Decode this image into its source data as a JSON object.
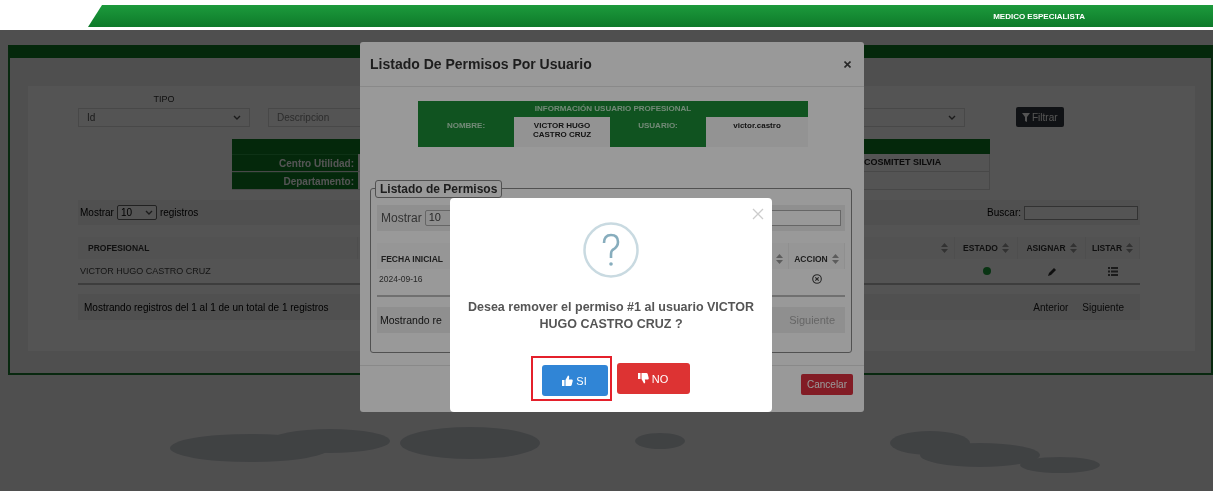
{
  "header": {
    "role": "MEDICO ESPECIALISTA"
  },
  "filter": {
    "tipo_label": "TIPO",
    "tipo_value": "Id",
    "descripcion_placeholder": "Descripcion",
    "filter_button": "Filtrar"
  },
  "info_table": {
    "rows": [
      {
        "label": "Centro Utilidad:",
        "value": "COSMITET SILVIA"
      },
      {
        "label": "Departamento:"
      }
    ]
  },
  "professionals": {
    "show_label": "Mostrar",
    "page_size": "10",
    "records_label": "registros",
    "search_label": "Buscar:",
    "columns": [
      {
        "label": "PROFESIONAL"
      },
      {
        "label": "ESTADO"
      },
      {
        "label": "ASIGNAR"
      },
      {
        "label": "LISTAR"
      }
    ],
    "rows": [
      {
        "profesional": "VICTOR HUGO CASTRO CRUZ",
        "active": true
      }
    ],
    "footer": "Mostrando registros del 1 al 1 de un total de 1 registros",
    "previous": "Anterior",
    "next": "Siguiente"
  },
  "modal": {
    "title": "Listado De Permisos Por Usuario",
    "info_title": "INFORMACIÓN USUARIO PROFESIONAL",
    "nombre_label": "NOMBRE:",
    "nombre_value": "VICTOR HUGO CASTRO CRUZ",
    "usuario_label": "USUARIO:",
    "usuario_value": "victor.castro",
    "legend": "Listado de Permisos",
    "show_label": "Mostrar",
    "page_size": "10",
    "columns": [
      {
        "label": "FECHA INICIAL"
      },
      {
        "label": "ACCION"
      }
    ],
    "rows": [
      {
        "fecha_inicial": "2024-09-16"
      }
    ],
    "footer": "Mostrando re",
    "next": "Siguiente",
    "cancel": "Cancelar"
  },
  "dialog": {
    "message": "Desea remover el permiso #1 al usuario VICTOR HUGO CASTRO CRUZ ?",
    "buttons": [
      {
        "label": "SI",
        "kind": "confirm",
        "highlighted": true
      },
      {
        "label": "NO",
        "kind": "cancel",
        "highlighted": false
      }
    ]
  }
}
